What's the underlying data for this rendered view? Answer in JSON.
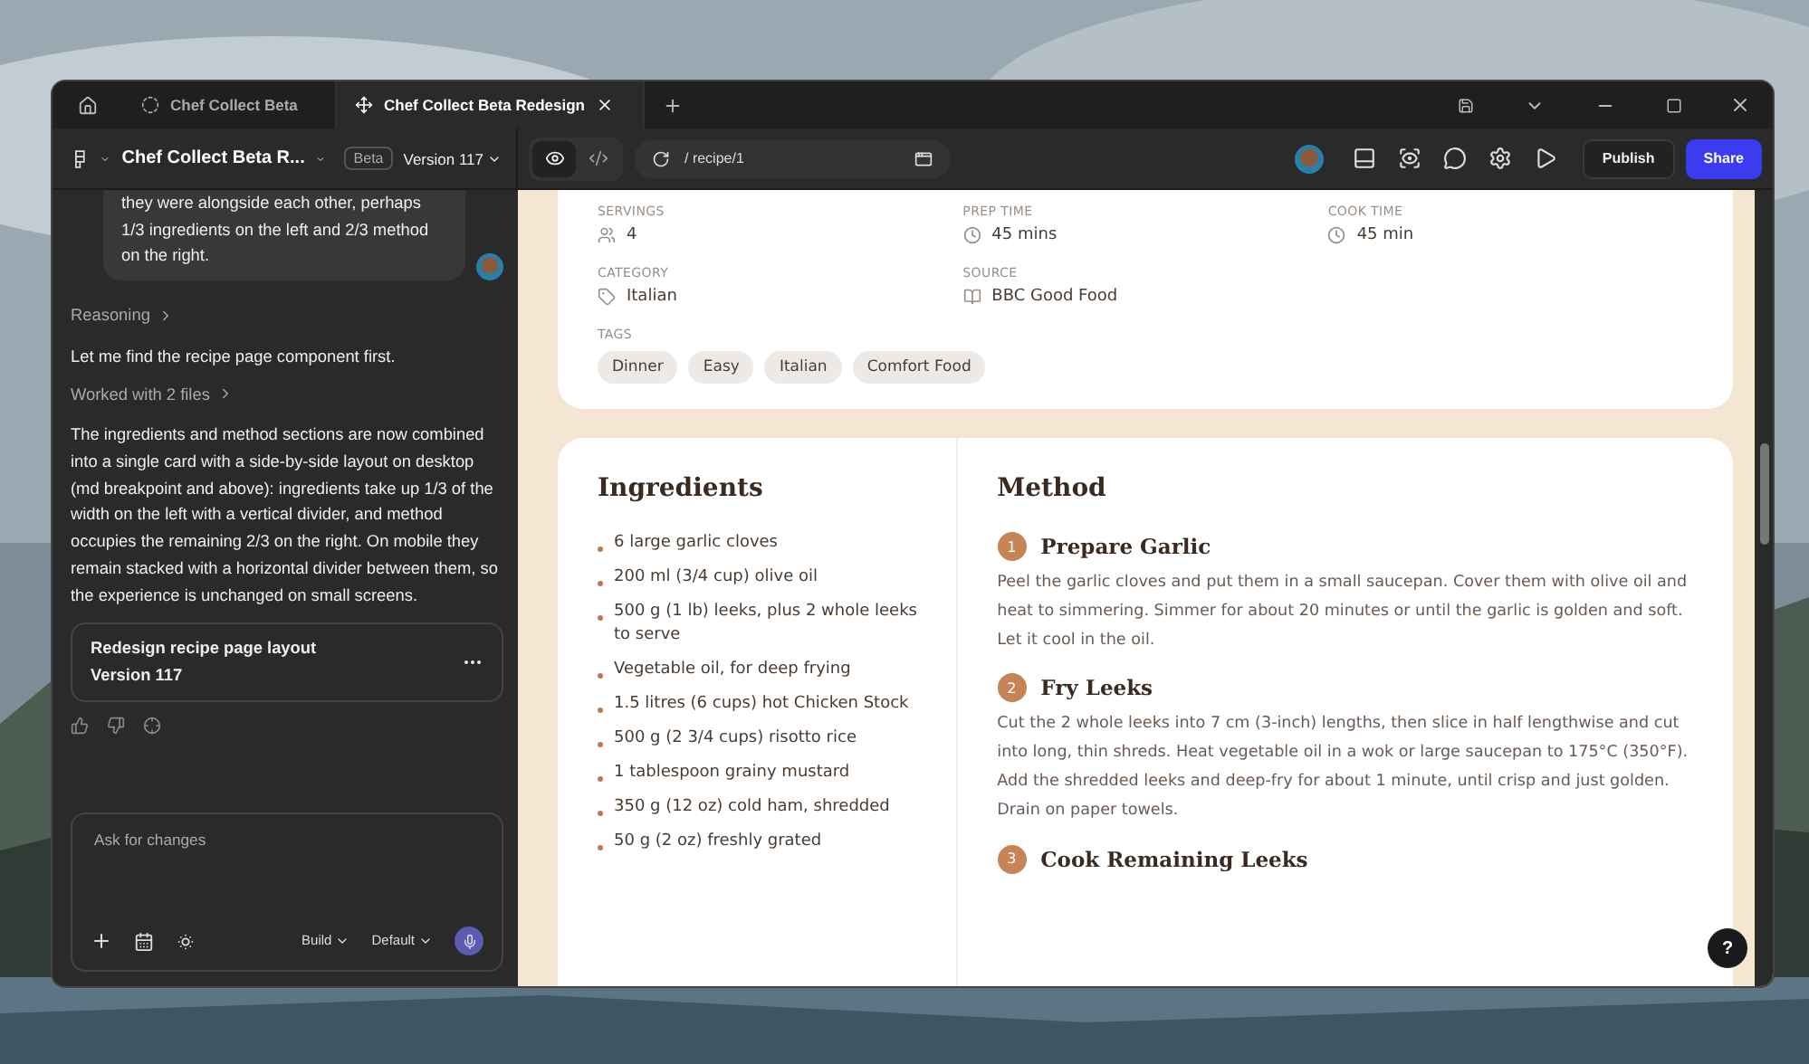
{
  "tabs": [
    {
      "label": "Chef Collect Beta",
      "selected": false
    },
    {
      "label": "Chef Collect Beta Redesign",
      "selected": true
    }
  ],
  "toolbar": {
    "project": "Chef Collect Beta R...",
    "badge": "Beta",
    "version": "Version 117",
    "views": [
      {
        "kind": "preview",
        "selected": true
      },
      {
        "kind": "code",
        "selected": false
      }
    ],
    "url": "/ recipe/1",
    "publish": "Publish",
    "share": "Share"
  },
  "chat": {
    "user_message": "they were alongside each other, perhaps 1/3 ingredients on the left and 2/3 method on the right.",
    "reasoning": "Reasoning",
    "intro": "Let me find the recipe page component first.",
    "worked": "Worked with 2 files",
    "answer": "The ingredients and method sections are now combined into a single card with a side-by-side layout on desktop (md breakpoint and above): ingredients take up 1/3 of the width on the left with a vertical divider, and method occupies the remaining 2/3 on the right. On mobile they remain stacked with a horizontal divider between them, so the experience is unchanged on small screens.",
    "version_card": {
      "title": "Redesign recipe page layout",
      "version": "Version 117"
    },
    "composer": {
      "placeholder": "Ask for changes",
      "mode": "Build",
      "model": "Default"
    }
  },
  "recipe": {
    "meta": [
      {
        "kind": "servings",
        "label": "SERVINGS",
        "value": "4"
      },
      {
        "kind": "prep",
        "label": "PREP TIME",
        "value": "45 mins"
      },
      {
        "kind": "cook",
        "label": "COOK TIME",
        "value": "45 min"
      },
      {
        "kind": "category",
        "label": "CATEGORY",
        "value": "Italian"
      },
      {
        "kind": "source",
        "label": "SOURCE",
        "value": "BBC Good Food"
      }
    ],
    "tags_label": "TAGS",
    "tags": [
      "Dinner",
      "Easy",
      "Italian",
      "Comfort Food"
    ],
    "ingredients_title": "Ingredients",
    "ingredients": [
      "6 large garlic cloves",
      "200 ml (3/4 cup) olive oil",
      "500 g (1 lb) leeks, plus 2 whole leeks to serve",
      "Vegetable oil, for deep frying",
      "1.5 litres (6 cups) hot Chicken Stock",
      "500 g (2 3/4 cups) risotto rice",
      "1 tablespoon grainy mustard",
      "350 g (12 oz) cold ham, shredded",
      "50 g (2 oz) freshly grated"
    ],
    "method_title": "Method",
    "steps": [
      {
        "number": "1",
        "title": "Prepare Garlic",
        "text": "Peel the garlic cloves and put them in a small saucepan. Cover them with olive oil and heat to simmering. Simmer for about 20 minutes or until the garlic is golden and soft. Let it cool in the oil."
      },
      {
        "number": "2",
        "title": "Fry Leeks",
        "text": "Cut the 2 whole leeks into 7 cm (3-inch) lengths, then slice in half lengthwise and cut into long, thin shreds. Heat vegetable oil in a wok or large saucepan to 175°C (350°F). Add the shredded leeks and deep-fry for about 1 minute, until crisp and just golden. Drain on paper towels."
      },
      {
        "number": "3",
        "title": "Cook Remaining Leeks"
      }
    ]
  },
  "help_button": "?"
}
